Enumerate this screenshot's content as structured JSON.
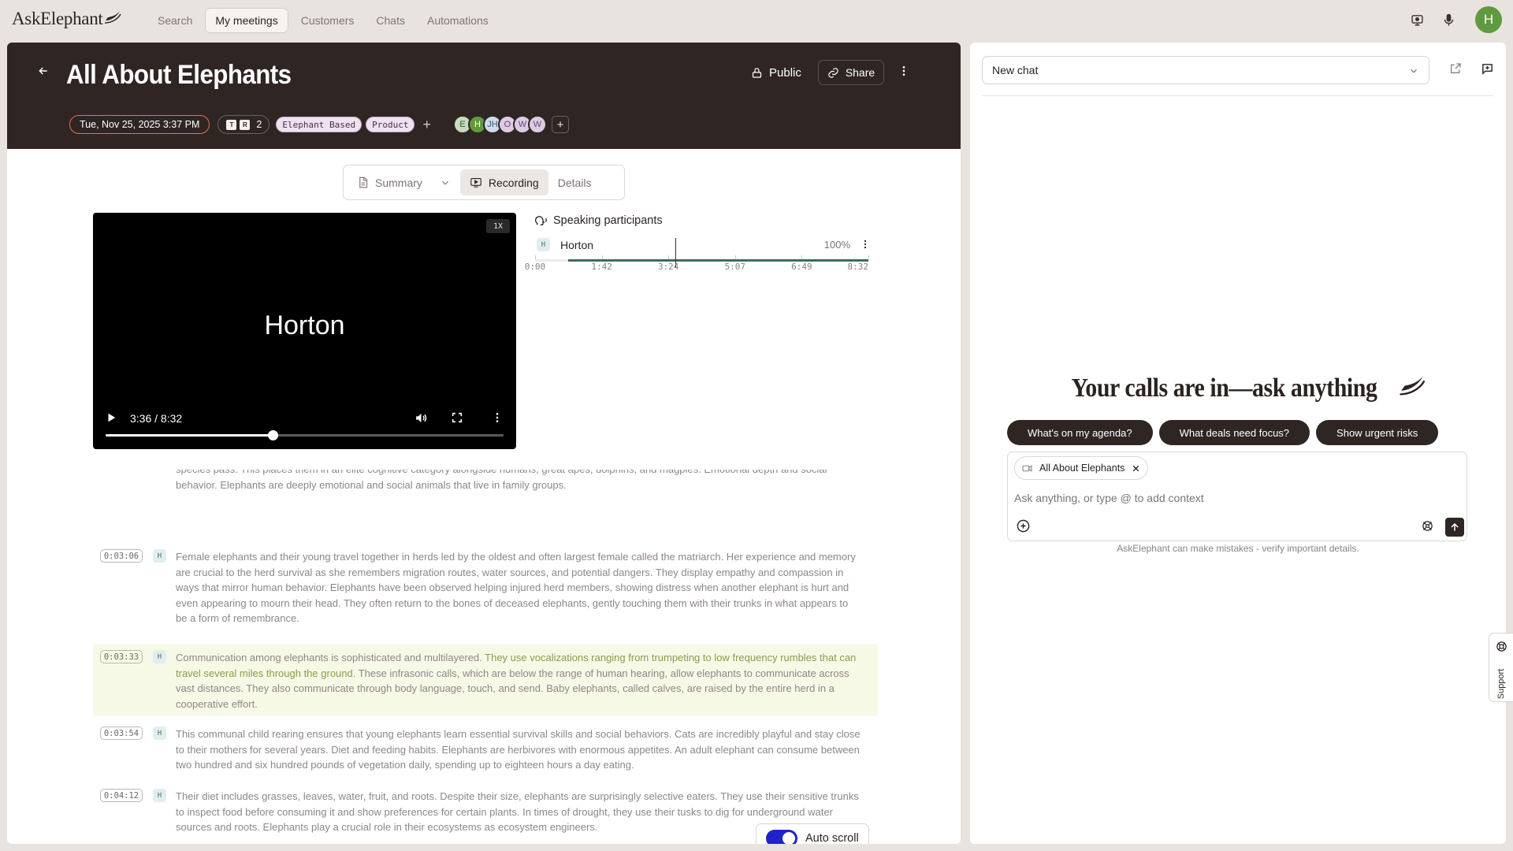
{
  "brand": {
    "name": "AskElephant"
  },
  "nav": {
    "tabs": [
      {
        "label": "Search"
      },
      {
        "label": "My meetings"
      },
      {
        "label": "Customers"
      },
      {
        "label": "Chats"
      },
      {
        "label": "Automations"
      }
    ],
    "active_tab": "My meetings",
    "user_initial": "H"
  },
  "meeting": {
    "title": "All About Elephants",
    "public_label": "Public",
    "share_label": "Share",
    "date": "Tue, Nov 25, 2025 3:37 PM",
    "source_icons": [
      "T",
      "R"
    ],
    "source_count": "2",
    "tags": [
      "Elephant Based",
      "Product"
    ],
    "participants": [
      {
        "initials": "E",
        "bg": "#c7dcbf",
        "fg": "#3b5b30"
      },
      {
        "initials": "H",
        "bg": "#5f9a3e",
        "fg": "#ffffff"
      },
      {
        "initials": "JH",
        "bg": "#cddbea",
        "fg": "#3c5676"
      },
      {
        "initials": "O",
        "bg": "#dccbe3",
        "fg": "#674877"
      },
      {
        "initials": "W",
        "bg": "#dccbe3",
        "fg": "#674877"
      },
      {
        "initials": "W",
        "bg": "#dccbe3",
        "fg": "#674877"
      }
    ]
  },
  "view_tabs": {
    "summary": "Summary",
    "recording": "Recording",
    "details": "Details",
    "active": "Recording"
  },
  "video": {
    "speed": "1X",
    "speaker_name": "Horton",
    "time": "3:36 / 8:32",
    "progress": 0.42
  },
  "speakers": {
    "heading": "Speaking participants",
    "list": [
      {
        "badge": "H",
        "name": "Horton",
        "percent": "100%",
        "talk_start": 0.1,
        "talk_end": 1.0
      }
    ],
    "cursor": 0.42,
    "ticks": [
      "0:00",
      "1:42",
      "3:24",
      "5:07",
      "6:49",
      "8:32"
    ]
  },
  "transcript": {
    "fragment": "species pass. This places them in an elite cognitive category alongside humans, great apes, dolphins, and magpies. Emotional depth and social behavior. Elephants are deeply emotional and social animals that live in family groups.",
    "entries": [
      {
        "time": "0:03:06",
        "badge": "H",
        "text": "Female elephants and their young travel together in herds led by the oldest and often largest female called the matriarch. Her experience and memory are crucial to the herd survival as she remembers migration routes, water sources, and potential dangers. They display empathy and compassion in ways that mirror human behavior. Elephants have been observed helping injured herd members, showing distress when another elephant is hurt and even appearing to mourn their head. They often return to the bones of deceased elephants, gently touching them with their trunks in what appears to be a form of remembrance."
      },
      {
        "time": "0:03:33",
        "badge": "H",
        "text_before": "Communication among elephants is sophisticated and multilayered. ",
        "text_highlight": "They use vocalizations ranging from trumpeting to low frequency rumbles that can travel several miles through the ground.",
        "text_after": " These infrasonic calls, which are below the range of human hearing, allow elephants to communicate across vast distances. They also communicate through body language, touch, and send. Baby elephants, called calves, are raised by the entire herd in a cooperative effort."
      },
      {
        "time": "0:03:54",
        "badge": "H",
        "text": "This communal child rearing ensures that young elephants learn essential survival skills and social behaviors. Cats are incredibly playful and stay close to their mothers for several years. Diet and feeding habits. Elephants are herbivores with enormous appetites. An adult elephant can consume between two hundred and six hundred pounds of vegetation daily, spending up to eighteen hours a day eating."
      },
      {
        "time": "0:04:12",
        "badge": "H",
        "text": "Their diet includes grasses, leaves, water, fruit, and roots. Despite their size, elephants are surprisingly selective eaters. They use their sensitive trunks to inspect food before consuming it and show preferences for certain plants. In times of drought, they use their tusks to dig for underground water sources and roots. Elephants play a crucial role in their ecosystems as ecosystem engineers."
      }
    ],
    "autoscroll_label": "Auto scroll",
    "autoscroll_on": true
  },
  "chat": {
    "selector": "New chat",
    "headline": "Your calls are in—ask anything",
    "suggestions": [
      "What's on my agenda?",
      "What deals need focus?",
      "Show urgent risks"
    ],
    "context_chip": "All About Elephants",
    "placeholder": "Ask anything, or type @ to add context",
    "disclaimer": "AskElephant can make mistakes - verify important details."
  },
  "support": {
    "label": "Support"
  }
}
